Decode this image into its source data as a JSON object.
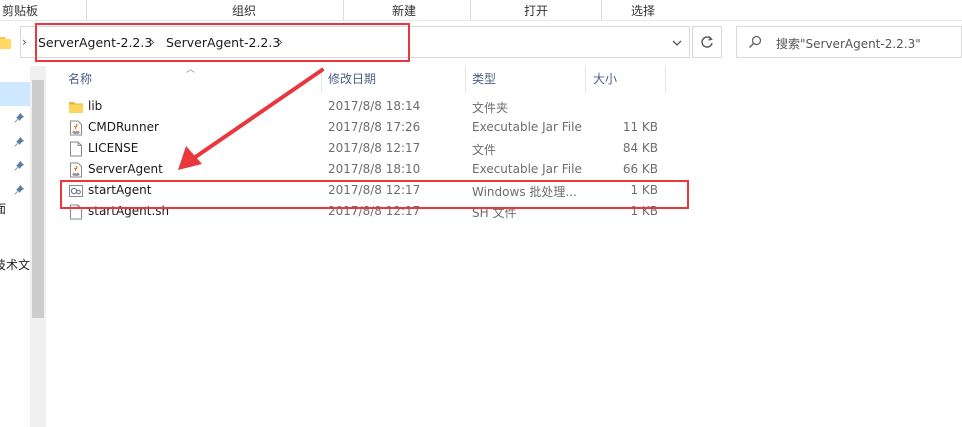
{
  "ribbon": {
    "groups": [
      "剪贴板",
      "组织",
      "新建",
      "打开",
      "选择"
    ]
  },
  "breadcrumb": {
    "items": [
      "ServerAgent-2.2.3",
      "ServerAgent-2.2.3"
    ]
  },
  "search": {
    "placeholder": "搜索\"ServerAgent-2.2.3\""
  },
  "nav_pane": {
    "fragments": [
      "面",
      "技术文"
    ]
  },
  "columns": {
    "name": "名称",
    "date": "修改日期",
    "type": "类型",
    "size": "大小"
  },
  "files": [
    {
      "name": "lib",
      "date": "2017/8/8 18:14",
      "type": "文件夹",
      "size": "",
      "icon": "folder-icon"
    },
    {
      "name": "CMDRunner",
      "date": "2017/8/8 17:26",
      "type": "Executable Jar File",
      "size": "11 KB",
      "icon": "jar-file-icon"
    },
    {
      "name": "LICENSE",
      "date": "2017/8/8 12:17",
      "type": "文件",
      "size": "84 KB",
      "icon": "blank-file-icon"
    },
    {
      "name": "ServerAgent",
      "date": "2017/8/8 18:10",
      "type": "Executable Jar File",
      "size": "66 KB",
      "icon": "jar-file-icon"
    },
    {
      "name": "startAgent",
      "date": "2017/8/8 12:17",
      "type": "Windows 批处理...",
      "size": "1 KB",
      "icon": "batch-file-icon"
    },
    {
      "name": "startAgent.sh",
      "date": "2017/8/8 12:17",
      "type": "SH 文件",
      "size": "1 KB",
      "icon": "blank-file-icon"
    }
  ],
  "colors": {
    "annotation": "#e8383d",
    "header_text": "#4d6082",
    "selection": "#cde8ff"
  }
}
